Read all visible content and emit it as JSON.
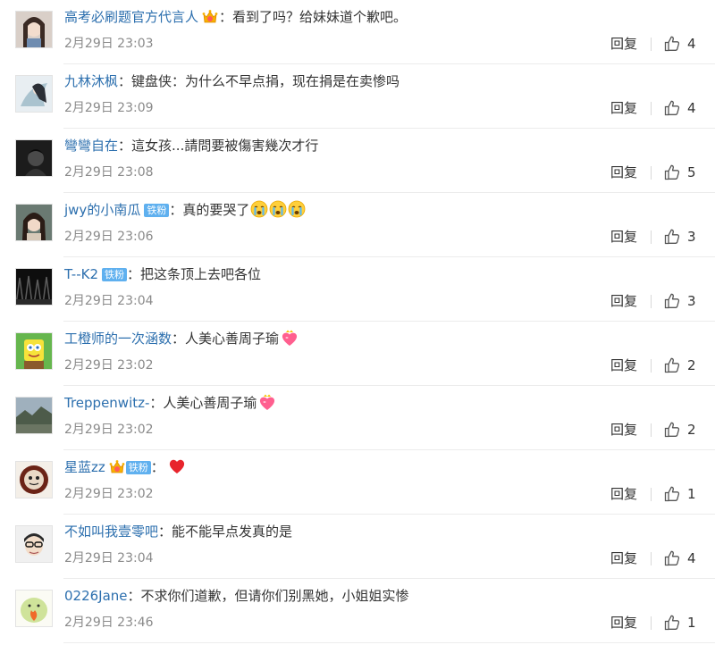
{
  "comments": [
    {
      "user": "高考必刷题官方代言人",
      "content": "看到了吗？给妹妹道个歉吧。",
      "time": "2月29日 23:03",
      "reply": "回复",
      "likes": "4"
    },
    {
      "user": "九林沐枫",
      "content": "键盘侠：为什么不早点捐，现在捐是在卖惨吗",
      "time": "2月29日 23:09",
      "reply": "回复",
      "likes": "4"
    },
    {
      "user": "彎彎自在",
      "content": "這女孩...請問要被傷害幾次才行",
      "time": "2月29日 23:08",
      "reply": "回复",
      "likes": "5"
    },
    {
      "user": "jwy的小南瓜",
      "badge": "铁粉",
      "content": "真的要哭了",
      "time": "2月29日 23:06",
      "reply": "回复",
      "likes": "3"
    },
    {
      "user": "T--K2",
      "badge": "铁粉",
      "content": "把这条顶上去吧各位",
      "time": "2月29日 23:04",
      "reply": "回复",
      "likes": "3"
    },
    {
      "user": "工橙师的一次涵数",
      "content": "人美心善周子瑜",
      "time": "2月29日 23:02",
      "reply": "回复",
      "likes": "2"
    },
    {
      "user": "Treppenwitz-",
      "content": "人美心善周子瑜",
      "time": "2月29日 23:02",
      "reply": "回复",
      "likes": "2"
    },
    {
      "user": "星蓝zz",
      "badge": "铁粉",
      "content": "",
      "time": "2月29日 23:02",
      "reply": "回复",
      "likes": "1"
    },
    {
      "user": "不如叫我壹零吧",
      "content": "能不能早点发真的是",
      "time": "2月29日 23:04",
      "reply": "回复",
      "likes": "4"
    },
    {
      "user": "0226Jane",
      "content": "不求你们道歉，但请你们别黑她，小姐姐实惨",
      "time": "2月29日 23:46",
      "reply": "回复",
      "likes": "1"
    }
  ],
  "colon": "：",
  "icons": {
    "like": "thumbs-up-icon",
    "vip": "vip-crown-badge-icon",
    "cry": "crying-face-emoji",
    "heart": "heart-emoji"
  },
  "colors": {
    "username": "#2c6fae",
    "fan_badge": "#5fb0ef",
    "time": "#8a8a8a",
    "heart": "#e8242c"
  }
}
